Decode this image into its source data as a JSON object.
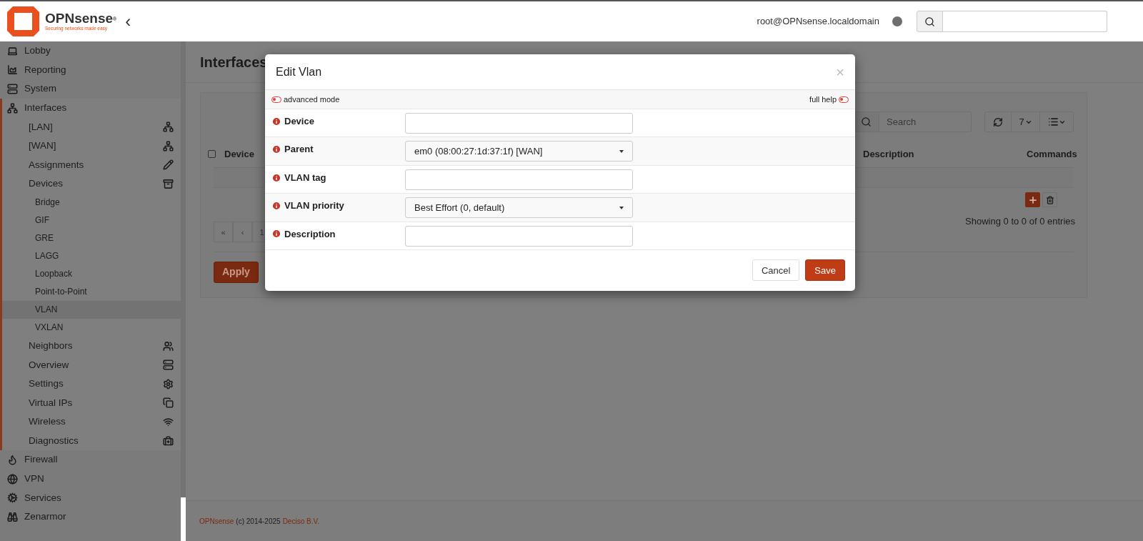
{
  "header": {
    "logo_name": "OPNsense",
    "logo_mark": "®",
    "tagline": "Securing networks made easy",
    "collapse": "‹",
    "user": "root@OPNsense.localdomain"
  },
  "sidebar": {
    "items": [
      {
        "label": "Lobby",
        "expanded": false
      },
      {
        "label": "Reporting",
        "expanded": false
      },
      {
        "label": "System",
        "expanded": false
      },
      {
        "label": "Interfaces",
        "expanded": true,
        "children": [
          {
            "label": "[LAN]",
            "selected": false
          },
          {
            "label": "[WAN]",
            "selected": false
          },
          {
            "label": "Assignments",
            "selected": false
          },
          {
            "label": "Devices",
            "selected": false,
            "children": [
              {
                "label": "Bridge",
                "selected": false
              },
              {
                "label": "GIF",
                "selected": false
              },
              {
                "label": "GRE",
                "selected": false
              },
              {
                "label": "LAGG",
                "selected": false
              },
              {
                "label": "Loopback",
                "selected": false
              },
              {
                "label": "Point-to-Point",
                "selected": false
              },
              {
                "label": "VLAN",
                "selected": true
              },
              {
                "label": "VXLAN",
                "selected": false
              }
            ]
          },
          {
            "label": "Neighbors",
            "selected": false
          },
          {
            "label": "Overview",
            "selected": false
          },
          {
            "label": "Settings",
            "selected": false
          },
          {
            "label": "Virtual IPs",
            "selected": false
          },
          {
            "label": "Wireless",
            "selected": false
          },
          {
            "label": "Diagnostics",
            "selected": false
          }
        ]
      },
      {
        "label": "Firewall",
        "expanded": false
      },
      {
        "label": "VPN",
        "expanded": false
      },
      {
        "label": "Services",
        "expanded": false
      },
      {
        "label": "Zenarmor",
        "expanded": false
      }
    ]
  },
  "page": {
    "title": "Interfaces",
    "search": {
      "placeholder": "Search"
    },
    "page_size": "7",
    "table": {
      "select_all": {
        "checked": false
      },
      "columns": [
        "Device",
        "Description",
        "Commands"
      ]
    },
    "pagination": [
      "«",
      "‹",
      "1"
    ],
    "info": "Showing 0 to 0 of 0 entries",
    "apply": "Apply"
  },
  "dialog": {
    "title": "Edit Vlan",
    "close": "×",
    "advanced_mode": {
      "label": "advanced mode",
      "checked": false
    },
    "full_help": {
      "label": "full help",
      "checked": false
    },
    "fields": [
      {
        "kind": "text",
        "label": "Device"
      },
      {
        "kind": "select",
        "label": "Parent",
        "value": "em0 (08:00:27:1d:37:1f) [WAN]"
      },
      {
        "kind": "text",
        "label": "VLAN tag"
      },
      {
        "kind": "select",
        "label": "VLAN priority",
        "value": "Best Effort (0, default)"
      },
      {
        "kind": "text",
        "label": "Description"
      }
    ],
    "buttons": [
      {
        "kind": "secondary",
        "label": "Cancel"
      },
      {
        "kind": "primary",
        "label": "Save"
      }
    ]
  },
  "footer": {
    "brand": "OPNsense",
    "text": "(c) 2014-2025",
    "company": "Deciso B.V."
  }
}
